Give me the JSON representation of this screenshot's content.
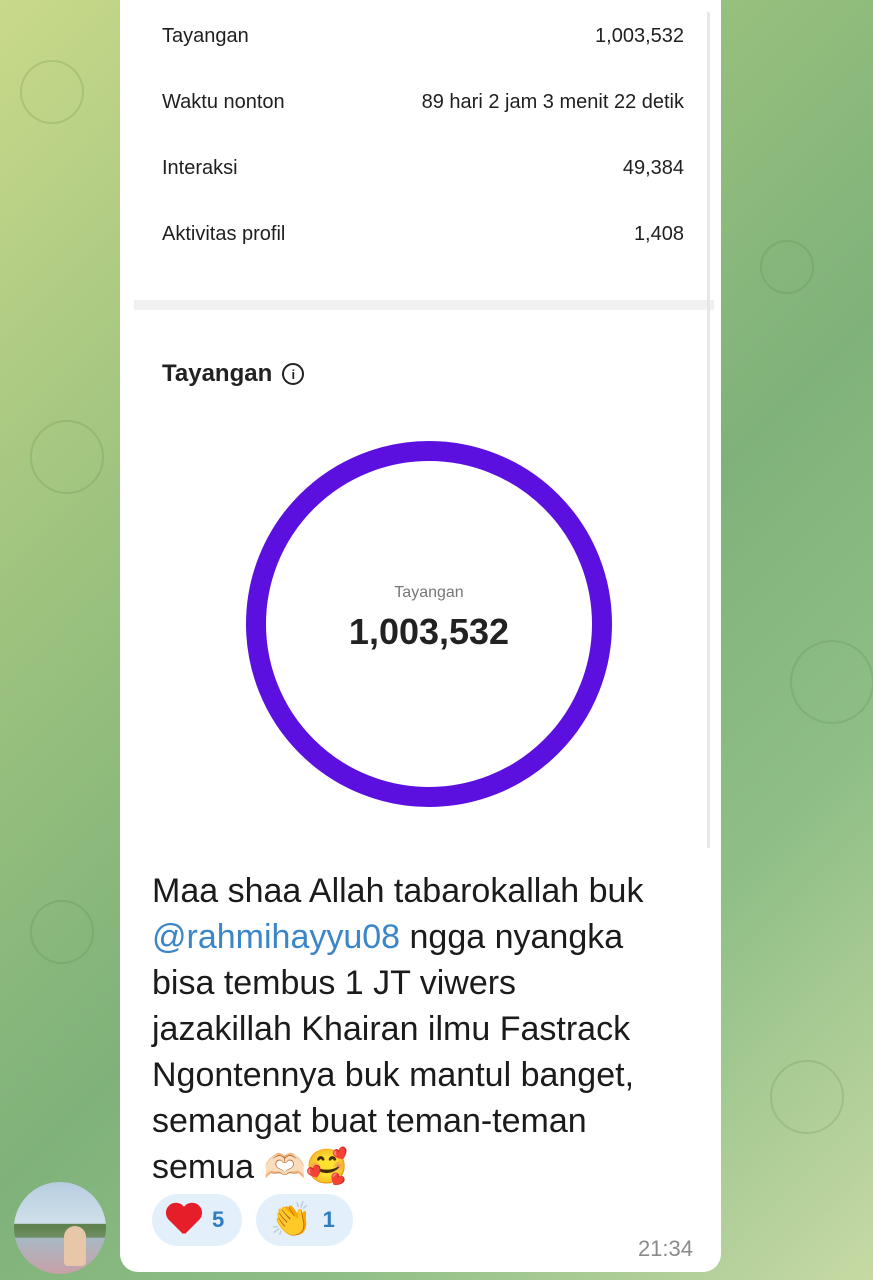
{
  "stats": [
    {
      "label": "Tayangan",
      "value": "1,003,532"
    },
    {
      "label": "Waktu nonton",
      "value": "89 hari 2 jam 3 menit 22 detik"
    },
    {
      "label": "Interaksi",
      "value": "49,384"
    },
    {
      "label": "Aktivitas profil",
      "value": "1,408"
    }
  ],
  "views_section": {
    "title": "Tayangan",
    "info_icon": "info-icon",
    "ring_label": "Tayangan",
    "ring_value": "1,003,532",
    "ring_color": "#5b10e0"
  },
  "message": {
    "line1": "Maa shaa Allah tabarokallah buk",
    "mention": "@rahmihayyu08",
    "line2_rest": " ngga nyangka",
    "line3": "bisa tembus 1 JT viwers",
    "line4": "jazakillah Khairan ilmu Fastrack",
    "line5": "Ngontennya buk mantul banget,",
    "line6": "semangat buat teman-teman",
    "line7": "semua 🫶🏻🥰",
    "time": "21:34"
  },
  "reactions": [
    {
      "emoji_name": "heart-icon",
      "count": "5"
    },
    {
      "emoji": "👏",
      "count": "1"
    }
  ],
  "colors": {
    "mention": "#3a86c8",
    "reaction_bg": "#e3f0fb",
    "reaction_count": "#2f7cc3"
  }
}
